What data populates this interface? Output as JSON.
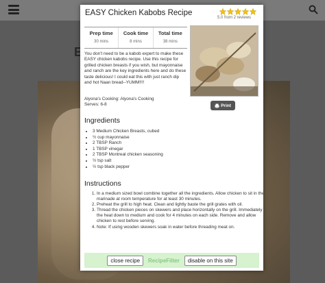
{
  "background": {
    "title_fragment": "E"
  },
  "modal": {
    "title": "EASY Chicken Kabobs Recipe",
    "rating_text": "5.0 from 2 reviews",
    "stars": 5,
    "times": [
      {
        "label": "Prep time",
        "value": "30 mins"
      },
      {
        "label": "Cook time",
        "value": "8 mins"
      },
      {
        "label": "Total time",
        "value": "38 mins"
      }
    ],
    "intro": "You don't need to be a kabob expert to make these EASY chicken kabobs recipe. Use this recipe for grilled chicken breasts if you wish, but mayonnaise and ranch are the key ingredients here and do these taste delicious! I could eat this with just ranch dip and hot Naan bread--YUMM!!!!",
    "author": "Alyona's Cooking: Alyona's Cooking",
    "serves": "Serves: 6-8",
    "print_label": "Print",
    "ingredients_heading": "Ingredients",
    "ingredients": [
      "3 Medium Chicken Breasts, cubed",
      "½ cup mayonnaise",
      "2 TBSP Ranch",
      "1 TBSP vinegar",
      "2 TBSP Montreal chicken seasoning",
      "½ tsp salt",
      "½ tsp black pepper"
    ],
    "instructions_heading": "Instructions",
    "instructions": [
      "In a medium sized bowl combine together all the ingredients. Allow chicken to sit in the marinade at room temperature for at least 30 minutes.",
      "Preheat the grill to high heat. Clean and lightly baste the grill grates with oil.",
      "Thread the chicken pieces on skewers and place horizontally on the grill. Immediately turn the heat down to medium and cook for 4 minutes on each side. Remove and allow chicken to rest before serving.",
      "Note: If using wooden skewers soak in water before threading meat on."
    ],
    "footer": {
      "close": "close recipe",
      "brand": "RecipeFilter",
      "disable": "disable on this site"
    }
  },
  "colors": {
    "star": "#f2c200",
    "footer_bg": "#d6f2cf",
    "brand": "#8cc783",
    "print_bg": "#555555"
  }
}
